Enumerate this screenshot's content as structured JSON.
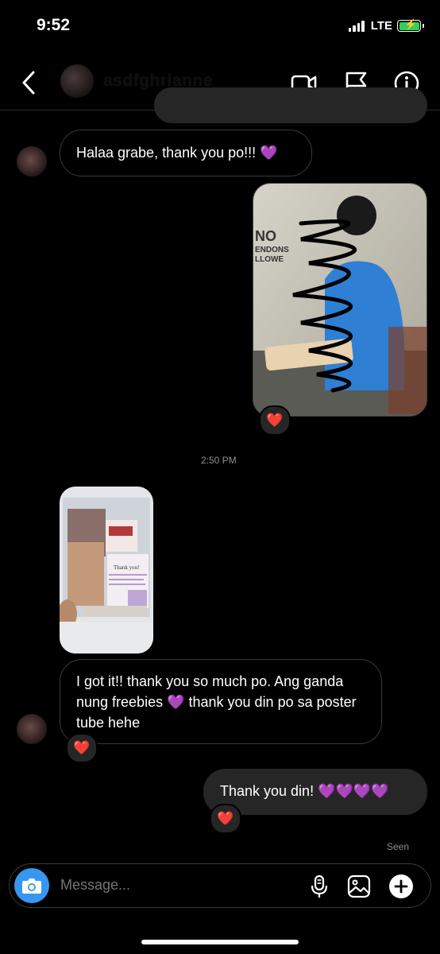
{
  "status_bar": {
    "time": "9:52",
    "network": "LTE"
  },
  "header": {
    "contact_name": "asdfghrianne"
  },
  "messages": [
    {
      "from": "them",
      "text": "Halaa grabe, thank you po!!! 💜"
    },
    {
      "from": "me",
      "type": "photo",
      "reaction": "❤️"
    },
    {
      "type": "timestamp",
      "text": "2:50 PM"
    },
    {
      "from": "them",
      "type": "photo",
      "photo_text": "Thank you!"
    },
    {
      "from": "them",
      "text": "I got it!! thank you so much po. Ang ganda nung freebies 💜 thank you din po sa poster tube hehe",
      "reaction": "❤️"
    },
    {
      "from": "me",
      "text": "Thank you din! 💜💜💜💜",
      "reaction": "❤️"
    }
  ],
  "seen_label": "Seen",
  "composer": {
    "placeholder": "Message..."
  },
  "colors": {
    "accent": "#3797f0",
    "bubble": "#262626",
    "heart": "#ff2d2d",
    "purple_heart": "#a35cff"
  }
}
